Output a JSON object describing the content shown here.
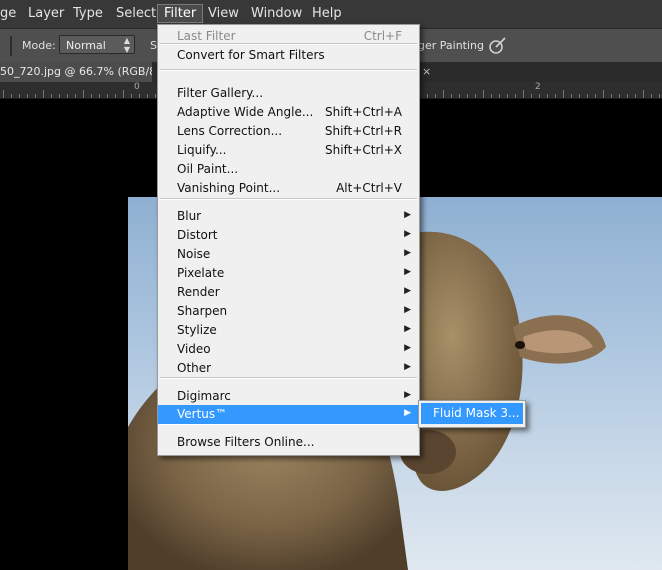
{
  "menubar": {
    "items": [
      "ge",
      "Layer",
      "Type",
      "Select",
      "Filter",
      "View",
      "Window",
      "Help"
    ],
    "active": "Filter"
  },
  "options": {
    "mode_label": "Mode:",
    "mode_value": "Normal",
    "strength_label_partial": "S",
    "finger_painting_partial": "ger Painting"
  },
  "document": {
    "tab_title": "50_720.jpg @ 66.7% (RGB/8#)",
    "close_glyph": "×"
  },
  "ruler": {
    "labels": [
      "0",
      "2"
    ]
  },
  "filter_menu": {
    "items": [
      {
        "label": "Last Filter",
        "shortcut": "Ctrl+F",
        "disabled": true
      },
      {
        "label": "Convert for Smart Filters"
      },
      {
        "label": "Filter Gallery..."
      },
      {
        "label": "Adaptive Wide Angle...",
        "shortcut": "Shift+Ctrl+A"
      },
      {
        "label": "Lens Correction...",
        "shortcut": "Shift+Ctrl+R"
      },
      {
        "label": "Liquify...",
        "shortcut": "Shift+Ctrl+X"
      },
      {
        "label": "Oil Paint..."
      },
      {
        "label": "Vanishing Point...",
        "shortcut": "Alt+Ctrl+V"
      },
      {
        "label": "Blur",
        "submenu": true
      },
      {
        "label": "Distort",
        "submenu": true
      },
      {
        "label": "Noise",
        "submenu": true
      },
      {
        "label": "Pixelate",
        "submenu": true
      },
      {
        "label": "Render",
        "submenu": true
      },
      {
        "label": "Sharpen",
        "submenu": true
      },
      {
        "label": "Stylize",
        "submenu": true
      },
      {
        "label": "Video",
        "submenu": true
      },
      {
        "label": "Other",
        "submenu": true
      },
      {
        "label": "Digimarc",
        "submenu": true
      },
      {
        "label": "Vertus™",
        "submenu": true,
        "highlighted": true
      },
      {
        "label": "Browse Filters Online..."
      }
    ],
    "arrow_glyph": "▶"
  },
  "vertus_submenu": {
    "items": [
      "Fluid Mask 3..."
    ]
  },
  "colors": {
    "highlight": "#3399ff",
    "menu_bg": "#f0f0f0",
    "app_bar": "#383838"
  }
}
